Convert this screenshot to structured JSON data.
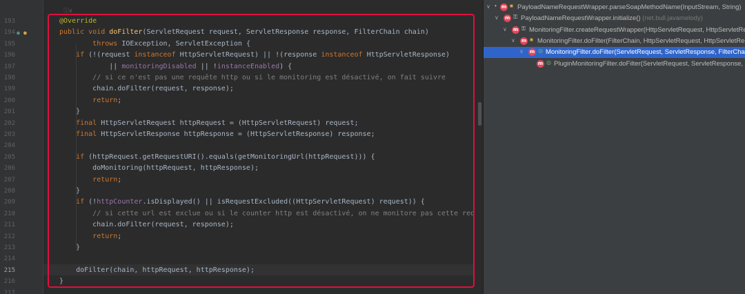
{
  "editor": {
    "fold_hint": "ⓘ∨",
    "lines": [
      {
        "n": "193",
        "parts": [
          {
            "c": "ann",
            "t": "@Override"
          }
        ]
      },
      {
        "n": "194",
        "parts": [
          {
            "c": "kw",
            "t": "public void "
          },
          {
            "c": "fn",
            "t": "doFilter"
          },
          {
            "c": "",
            "t": "(ServletRequest request, ServletResponse response, FilterChain chain)"
          }
        ]
      },
      {
        "n": "195",
        "parts": [
          {
            "c": "",
            "t": "        "
          },
          {
            "c": "kw",
            "t": "throws "
          },
          {
            "c": "",
            "t": "IOException, ServletException {"
          }
        ]
      },
      {
        "n": "196",
        "parts": [
          {
            "c": "",
            "t": "    "
          },
          {
            "c": "kw",
            "t": "if "
          },
          {
            "c": "",
            "t": "(!(request "
          },
          {
            "c": "kw",
            "t": "instanceof "
          },
          {
            "c": "",
            "t": "HttpServletRequest) || !(response "
          },
          {
            "c": "kw",
            "t": "instanceof "
          },
          {
            "c": "",
            "t": "HttpServletResponse)"
          }
        ]
      },
      {
        "n": "197",
        "parts": [
          {
            "c": "",
            "t": "            || "
          },
          {
            "c": "field",
            "t": "monitoringDisabled"
          },
          {
            "c": "",
            "t": " || !"
          },
          {
            "c": "field",
            "t": "instanceEnabled"
          },
          {
            "c": "",
            "t": ") {"
          }
        ]
      },
      {
        "n": "198",
        "parts": [
          {
            "c": "",
            "t": "        "
          },
          {
            "c": "cmt",
            "t": "// si ce n'est pas une requête http ou si le monitoring est désactivé, on fait suivre"
          }
        ]
      },
      {
        "n": "199",
        "parts": [
          {
            "c": "",
            "t": "        chain.doFilter(request, response);"
          }
        ]
      },
      {
        "n": "200",
        "parts": [
          {
            "c": "",
            "t": "        "
          },
          {
            "c": "kw",
            "t": "return"
          },
          {
            "c": "",
            "t": ";"
          }
        ]
      },
      {
        "n": "201",
        "parts": [
          {
            "c": "",
            "t": "    }"
          }
        ]
      },
      {
        "n": "202",
        "parts": [
          {
            "c": "",
            "t": "    "
          },
          {
            "c": "kw",
            "t": "final "
          },
          {
            "c": "",
            "t": "HttpServletRequest httpRequest = (HttpServletRequest) request;"
          }
        ]
      },
      {
        "n": "203",
        "parts": [
          {
            "c": "",
            "t": "    "
          },
          {
            "c": "kw",
            "t": "final "
          },
          {
            "c": "",
            "t": "HttpServletResponse httpResponse = (HttpServletResponse) response;"
          }
        ]
      },
      {
        "n": "204",
        "parts": []
      },
      {
        "n": "205",
        "parts": [
          {
            "c": "",
            "t": "    "
          },
          {
            "c": "kw",
            "t": "if "
          },
          {
            "c": "",
            "t": "(httpRequest.getRequestURI().equals(getMonitoringUrl(httpRequest))) {"
          }
        ]
      },
      {
        "n": "206",
        "parts": [
          {
            "c": "",
            "t": "        doMonitoring(httpRequest, httpResponse);"
          }
        ]
      },
      {
        "n": "207",
        "parts": [
          {
            "c": "",
            "t": "        "
          },
          {
            "c": "kw",
            "t": "return"
          },
          {
            "c": "",
            "t": ";"
          }
        ]
      },
      {
        "n": "208",
        "parts": [
          {
            "c": "",
            "t": "    }"
          }
        ]
      },
      {
        "n": "209",
        "parts": [
          {
            "c": "",
            "t": "    "
          },
          {
            "c": "kw",
            "t": "if "
          },
          {
            "c": "",
            "t": "(!"
          },
          {
            "c": "field",
            "t": "httpCounter"
          },
          {
            "c": "",
            "t": ".isDisplayed() || isRequestExcluded((HttpServletRequest) request)) {"
          }
        ]
      },
      {
        "n": "210",
        "parts": [
          {
            "c": "",
            "t": "        "
          },
          {
            "c": "cmt",
            "t": "// si cette url est exclue ou si le counter http est désactivé, on ne monitore pas cette requête"
          }
        ]
      },
      {
        "n": "211",
        "parts": [
          {
            "c": "",
            "t": "        chain.doFilter(request, response);"
          }
        ]
      },
      {
        "n": "212",
        "parts": [
          {
            "c": "",
            "t": "        "
          },
          {
            "c": "kw",
            "t": "return"
          },
          {
            "c": "",
            "t": ";"
          }
        ]
      },
      {
        "n": "213",
        "parts": [
          {
            "c": "",
            "t": "    }"
          }
        ]
      },
      {
        "n": "214",
        "parts": []
      },
      {
        "n": "215",
        "parts": [
          {
            "c": "",
            "t": "    doFilter(chain, httpRequest, httpResponse);"
          }
        ]
      },
      {
        "n": "216",
        "parts": [
          {
            "c": "",
            "t": "}"
          }
        ]
      },
      {
        "n": "217",
        "parts": []
      }
    ]
  },
  "tree": {
    "rows": [
      {
        "arrow": "∨",
        "mod": "lock",
        "text": "PayloadNameRequestWrapper.parseSoapMethodName(InputStream, String)",
        "pkg": "",
        "selected": false
      },
      {
        "arrow": "∨",
        "mod": "key",
        "text": "PayloadNameRequestWrapper.initialize()",
        "pkg": "(net.bull.javamelody)",
        "selected": false
      },
      {
        "arrow": "∨",
        "mod": "key",
        "text": "MonitoringFilter.createRequestWrapper(HttpServletRequest, HttpServletResponse)",
        "pkg": "",
        "selected": false
      },
      {
        "arrow": "∨",
        "mod": "lock",
        "text": "MonitoringFilter.doFilter(FilterChain, HttpServletRequest, HttpServletResponse)",
        "pkg": "",
        "selected": false
      },
      {
        "arrow": "∨",
        "mod": "open",
        "text": "MonitoringFilter.doFilter(ServletRequest, ServletResponse, FilterChain)",
        "pkg": "",
        "selected": true
      },
      {
        "arrow": "",
        "mod": "open",
        "text": "PluginMonitoringFilter.doFilter(ServletRequest, ServletResponse, FilterChain)",
        "pkg": "",
        "selected": false
      }
    ],
    "method_badge": "m",
    "top_marker": "•"
  },
  "colors": {
    "keyword": "#cc7832",
    "annotation": "#bbb529",
    "method": "#ffc66d",
    "field": "#9876aa",
    "comment": "#808080",
    "selection_border": "#e0103e",
    "tree_selection": "#2f65ca"
  }
}
